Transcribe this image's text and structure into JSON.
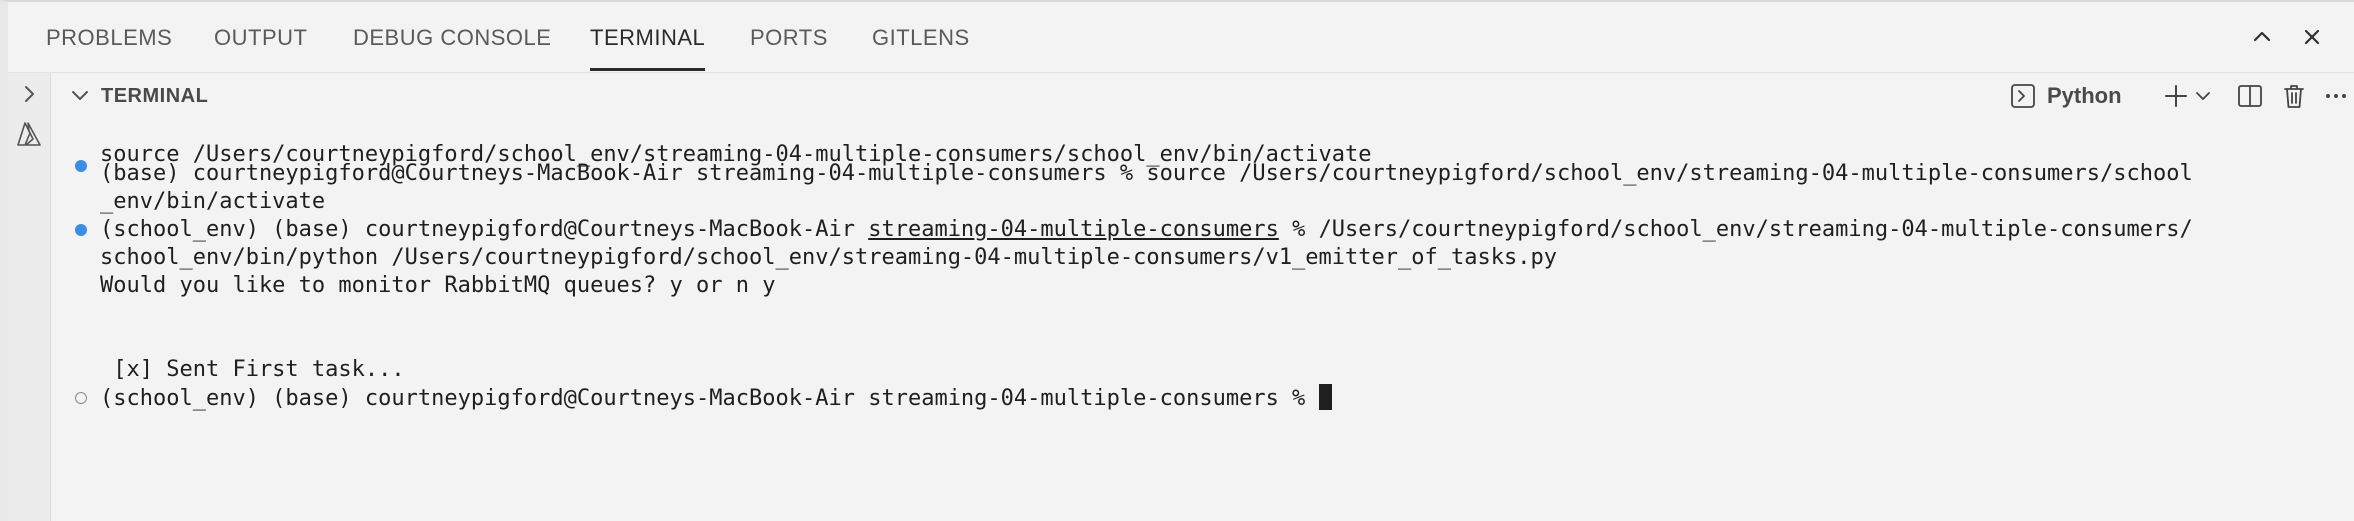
{
  "panel": {
    "tabs": [
      {
        "label": "PROBLEMS"
      },
      {
        "label": "OUTPUT"
      },
      {
        "label": "DEBUG CONSOLE"
      },
      {
        "label": "TERMINAL"
      },
      {
        "label": "PORTS"
      },
      {
        "label": "GITLENS"
      }
    ],
    "active_tab": "TERMINAL",
    "actions": [
      "maximize-panel-icon",
      "close-panel-icon"
    ]
  },
  "sidebar": {
    "icons": [
      "chevron-right-icon",
      "azure-icon"
    ]
  },
  "terminal": {
    "header": {
      "title": "TERMINAL",
      "profile_label": "Python",
      "actions": [
        "python-terminal-icon",
        "add-terminal-icon",
        "launch-profile-dropdown-icon",
        "split-terminal-icon",
        "kill-terminal-icon",
        "more-actions-icon"
      ]
    },
    "lines": [
      {
        "text": "source /Users/courtneypigford/school_env/streaming-04-multiple-consumers/school_env/bin/activate",
        "decoration": "none"
      },
      {
        "text": "(base) courtneypigford@Courtneys-MacBook-Air streaming-04-multiple-consumers % source /Users/courtneypigford/school_env/streaming-04-multiple-consumers/school",
        "decoration": "success"
      },
      {
        "text": "_env/bin/activate",
        "decoration": "none"
      },
      {
        "pre": "(school_env) (base) courtneypigford@Courtneys-MacBook-Air ",
        "link": "streaming-04-multiple-consumers",
        "post": " % /Users/courtneypigford/school_env/streaming-04-multiple-consumers/",
        "decoration": "success"
      },
      {
        "text": "school_env/bin/python /Users/courtneypigford/school_env/streaming-04-multiple-consumers/v1_emitter_of_tasks.py",
        "decoration": "none"
      },
      {
        "text": "Would you like to monitor RabbitMQ queues? y or n y",
        "decoration": "none"
      },
      {
        "text": "",
        "decoration": "none"
      },
      {
        "text": "",
        "decoration": "none"
      },
      {
        "text": " [x] Sent First task...",
        "decoration": "none"
      },
      {
        "text": "(school_env) (base) courtneypigford@Courtneys-MacBook-Air streaming-04-multiple-consumers % ",
        "decoration": "empty"
      }
    ]
  },
  "colors": {
    "background": "#f3f3f3",
    "text": "#1f1f1f",
    "accent": "#3a8ee6",
    "active_tab_underline": "#2b2b2b"
  }
}
